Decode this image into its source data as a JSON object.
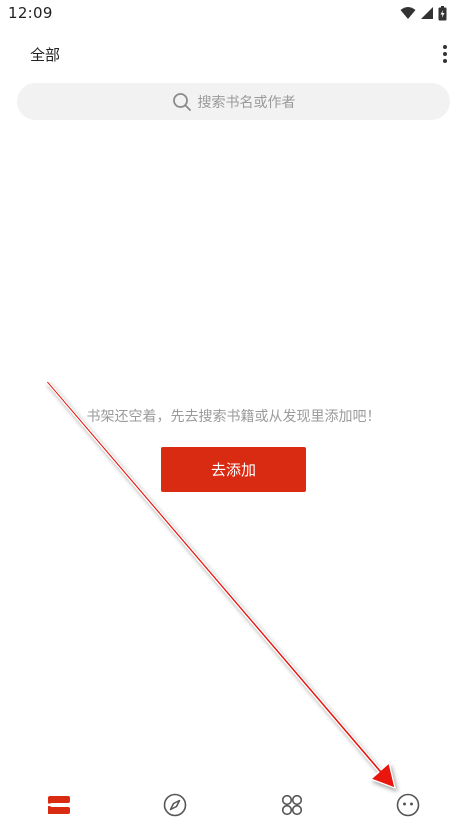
{
  "status_bar": {
    "time": "12:09",
    "icons": [
      "wifi-icon",
      "signal-icon",
      "battery-icon"
    ]
  },
  "header": {
    "title": "全部",
    "menu_icon": "more-vertical-icon"
  },
  "search": {
    "placeholder": "搜索书名或作者",
    "icon": "search-icon"
  },
  "empty_state": {
    "message": "书架还空着，先去搜索书籍或从发现里添加吧！",
    "button_label": "去添加"
  },
  "bottom_nav": {
    "items": [
      {
        "icon": "bookshelf-icon",
        "active": true
      },
      {
        "icon": "compass-icon",
        "active": false
      },
      {
        "icon": "category-icon",
        "active": false
      },
      {
        "icon": "profile-icon",
        "active": false
      }
    ]
  },
  "colors": {
    "accent": "#d92a12",
    "arrow": "#e8150f",
    "placeholder_text": "#9a9a9a",
    "search_bg": "#f2f2f2"
  }
}
